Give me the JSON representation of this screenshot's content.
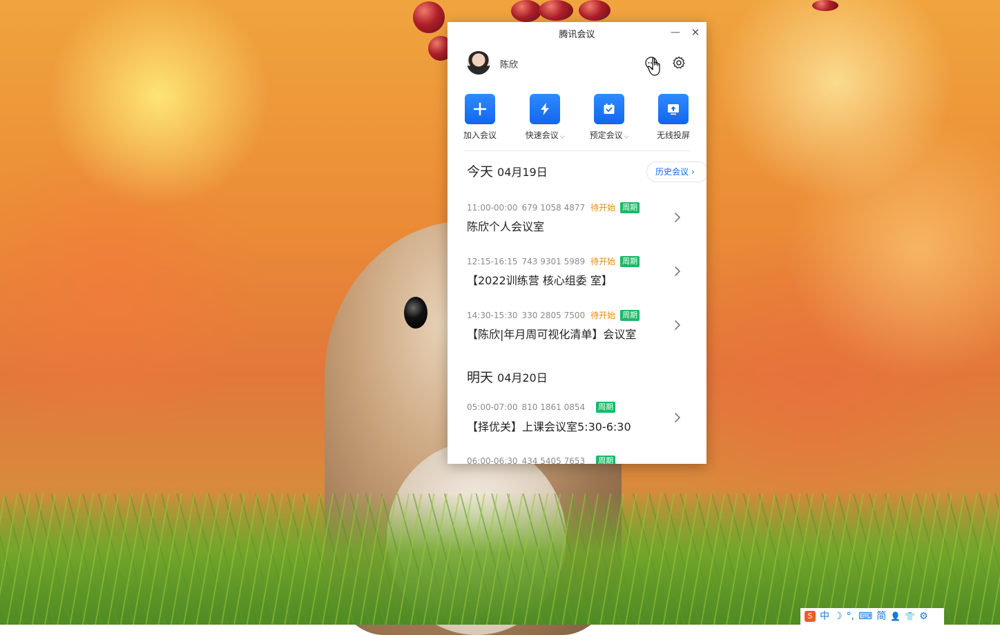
{
  "window": {
    "title": "腾讯会议",
    "minimize": "—",
    "close": "✕"
  },
  "user": {
    "name": "陈欣"
  },
  "actions": [
    {
      "label": "加入会议",
      "caret": "",
      "icon": "plus-icon"
    },
    {
      "label": "快速会议",
      "caret": "⌵",
      "icon": "lightning-icon"
    },
    {
      "label": "预定会议",
      "caret": "⌵",
      "icon": "calendar-icon"
    },
    {
      "label": "无线投屏",
      "caret": "",
      "icon": "screen-cast-icon"
    }
  ],
  "today": {
    "label": "今天",
    "date": "04月19日",
    "history_button": "历史会议 ›"
  },
  "tomorrow": {
    "label": "明天",
    "date": "04月20日"
  },
  "meetings": [
    {
      "time": "11:00-00:00",
      "id": "679 1058 4877",
      "status": "待开始",
      "tag": "周期",
      "title": "陈欣个人会议室"
    },
    {
      "time": "12:15-16:15",
      "id": "743 9301 5989",
      "status": "待开始",
      "tag": "周期",
      "title": "【2022训练营 核心组委 室】"
    },
    {
      "time": "14:30-15:30",
      "id": "330 2805 7500",
      "status": "待开始",
      "tag": "周期",
      "title": "【陈欣|年月周可视化清单】会议室"
    },
    {
      "time": "05:00-07:00",
      "id": "810 1861 0854",
      "status": "",
      "tag": "周期",
      "title": "【择优关】上课会议室5:30-6:30"
    },
    {
      "time": "06:00-06:30",
      "id": "434 5405 7653",
      "status": "",
      "tag": "周期",
      "title": ""
    }
  ],
  "ime": {
    "logo": "S",
    "mode": "中",
    "moon": "☽",
    "punct": "°,",
    "keyboard": "⌨",
    "simplified": "简",
    "person": "👤",
    "shirt": "👕",
    "settings": "⚙"
  }
}
